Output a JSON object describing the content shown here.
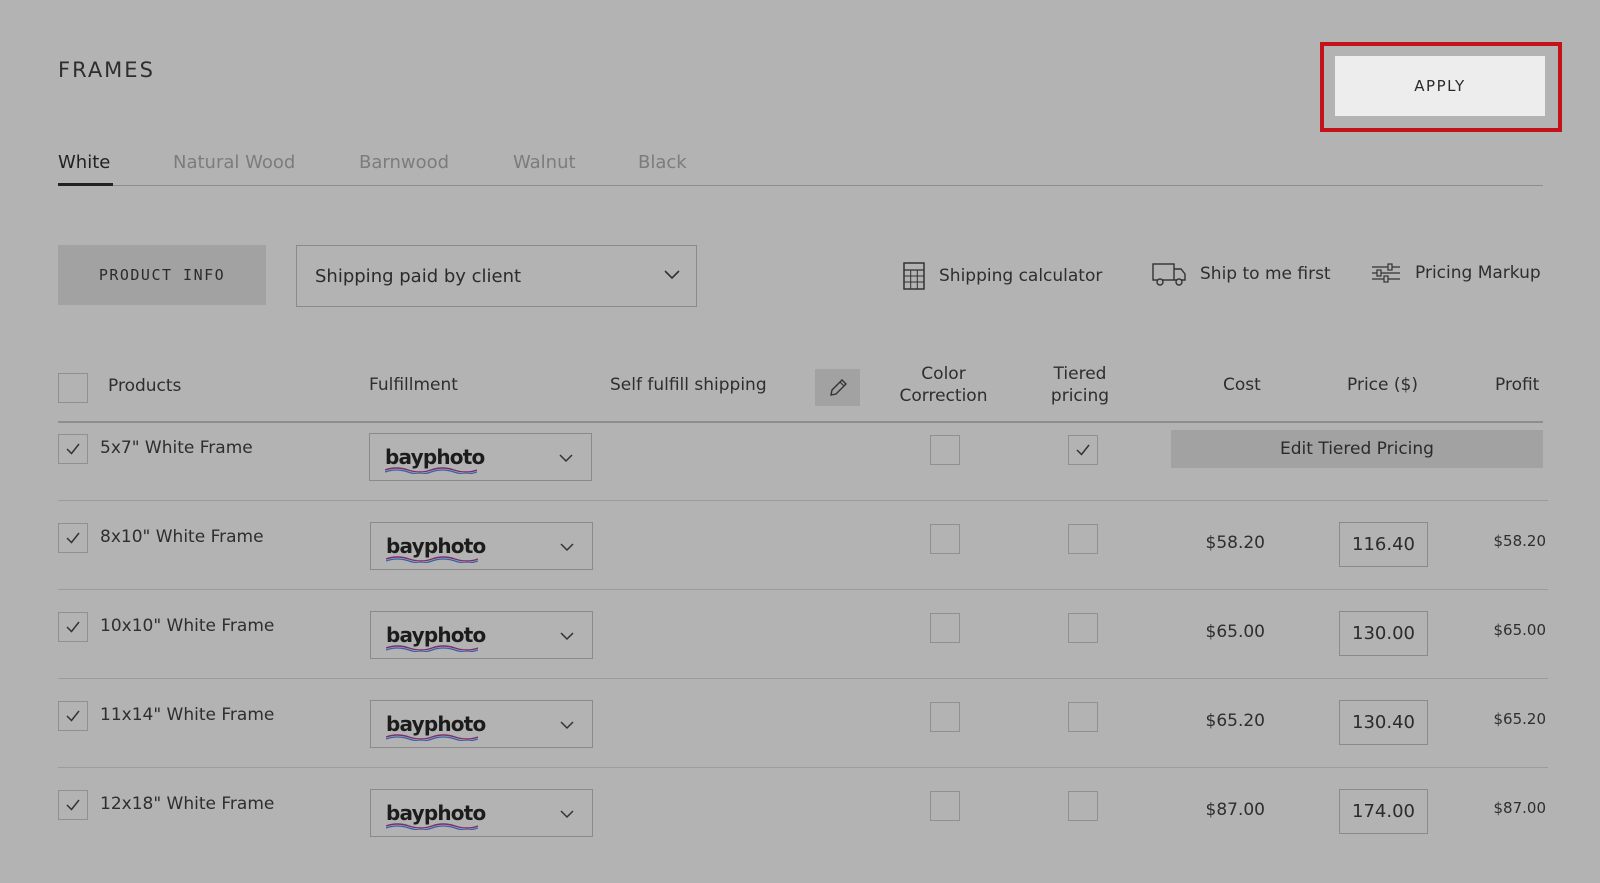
{
  "page": {
    "title": "FRAMES"
  },
  "apply_button": {
    "label": "APPLY"
  },
  "tabs": [
    {
      "label": "White",
      "active": true
    },
    {
      "label": "Natural Wood",
      "active": false
    },
    {
      "label": "Barnwood",
      "active": false
    },
    {
      "label": "Walnut",
      "active": false
    },
    {
      "label": "Black",
      "active": false
    }
  ],
  "toolbar": {
    "product_info_label": "PRODUCT INFO",
    "shipping_select_value": "Shipping paid by client",
    "shipping_calculator_label": "Shipping calculator",
    "ship_to_me_label": "Ship to me first",
    "pricing_markup_label": "Pricing Markup"
  },
  "table": {
    "headers": {
      "products": "Products",
      "fulfillment": "Fulfillment",
      "self_fulfill": "Self fulfill shipping",
      "color_correction_1": "Color",
      "color_correction_2": "Correction",
      "tiered_1": "Tiered",
      "tiered_2": "pricing",
      "cost": "Cost",
      "price": "Price ($)",
      "profit": "Profit"
    },
    "select_all_checked": false,
    "edit_tiered_pricing_label": "Edit Tiered Pricing",
    "rows": [
      {
        "name": "5x7\" White Frame",
        "selected": true,
        "vendor": "bayphoto",
        "color_correction": false,
        "tiered": true,
        "cost": "",
        "price": "",
        "profit": ""
      },
      {
        "name": "8x10\" White Frame",
        "selected": true,
        "vendor": "bayphoto",
        "color_correction": false,
        "tiered": false,
        "cost": "$58.20",
        "price": "116.40",
        "profit": "$58.20"
      },
      {
        "name": "10x10\" White Frame",
        "selected": true,
        "vendor": "bayphoto",
        "color_correction": false,
        "tiered": false,
        "cost": "$65.00",
        "price": "130.00",
        "profit": "$65.00"
      },
      {
        "name": "11x14\" White Frame",
        "selected": true,
        "vendor": "bayphoto",
        "color_correction": false,
        "tiered": false,
        "cost": "$65.20",
        "price": "130.40",
        "profit": "$65.20"
      },
      {
        "name": "12x18\" White Frame",
        "selected": true,
        "vendor": "bayphoto",
        "color_correction": false,
        "tiered": false,
        "cost": "$87.00",
        "price": "174.00",
        "profit": "$87.00"
      }
    ]
  },
  "colors": {
    "highlight": "#c4121b",
    "background": "#b3b3b3"
  }
}
